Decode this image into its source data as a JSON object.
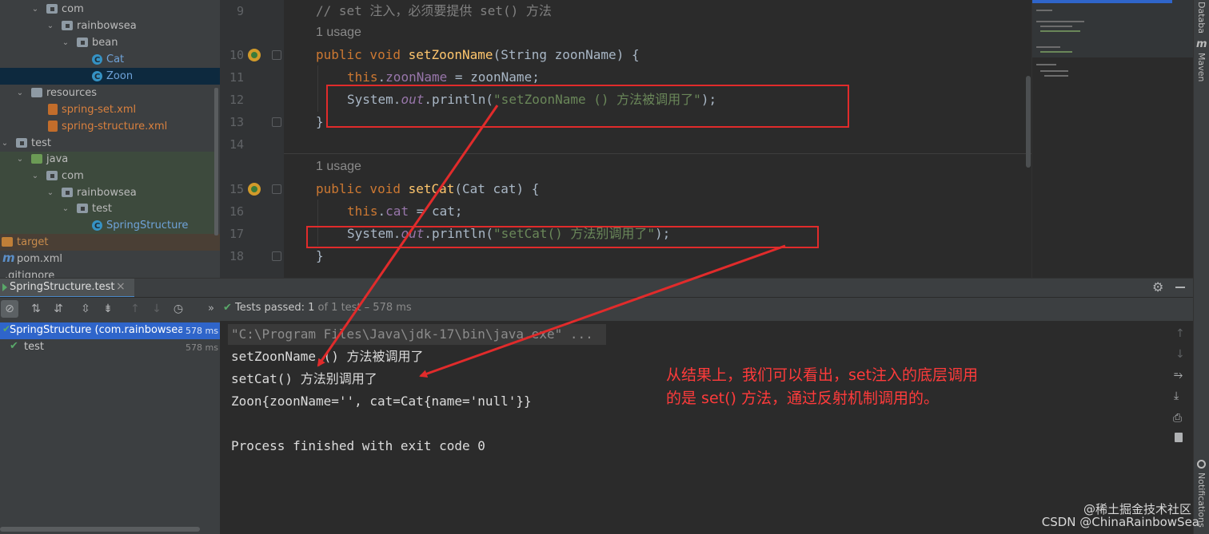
{
  "project_tree": {
    "items": [
      {
        "label": "com",
        "kind": "folder",
        "open": true
      },
      {
        "label": "rainbowsea",
        "kind": "folder",
        "open": true
      },
      {
        "label": "bean",
        "kind": "folder",
        "open": true
      },
      {
        "label": "Cat",
        "kind": "class"
      },
      {
        "label": "Zoon",
        "kind": "class",
        "selected": true
      },
      {
        "label": "resources",
        "kind": "res",
        "open": true
      },
      {
        "label": "spring-set.xml",
        "kind": "xml"
      },
      {
        "label": "spring-structure.xml",
        "kind": "xml"
      },
      {
        "label": "test",
        "kind": "folder",
        "open": true
      },
      {
        "label": "java",
        "kind": "src",
        "open": true
      },
      {
        "label": "com",
        "kind": "folder",
        "open": true
      },
      {
        "label": "rainbowsea",
        "kind": "folder",
        "open": true
      },
      {
        "label": "test",
        "kind": "folder",
        "open": true
      },
      {
        "label": "SpringStructure",
        "kind": "class"
      },
      {
        "label": "target",
        "kind": "tgt"
      },
      {
        "label": "pom.xml",
        "kind": "mvn"
      },
      {
        "label": ".gitignore",
        "kind": "plain"
      }
    ]
  },
  "editor": {
    "line_numbers": [
      "9",
      "10",
      "11",
      "12",
      "13",
      "14",
      "15",
      "16",
      "17",
      "18"
    ],
    "comment": "// set 注入，必须要提供 set() 方法",
    "usage_hint": "1 usage",
    "method1": {
      "mod": "public void ",
      "name": "setZoonName",
      "params": "(String zoonName) {"
    },
    "assign1": {
      "kw": "this",
      "dot": ".",
      "field": "zoonName",
      "rest": " = zoonName;"
    },
    "print1": {
      "pre": "System.",
      "out": "out",
      "mid": ".println(",
      "str": "\"setZoonName () 方法被调用了\"",
      "end": ");"
    },
    "close": "}",
    "method2": {
      "mod": "public void ",
      "name": "setCat",
      "params": "(Cat cat) {"
    },
    "assign2": {
      "kw": "this",
      "dot": ".",
      "field": "cat",
      "rest": " = cat;"
    },
    "print2": {
      "pre": "System.",
      "out": "out",
      "mid": ".println(",
      "str": "\"setCat() 方法别调用了\"",
      "end": ");"
    }
  },
  "right_bar": {
    "database": "Database",
    "maven": "Maven",
    "notifications": "Notifications"
  },
  "run_panel": {
    "tab_title": "SpringStructure.test",
    "close_glyph": "×",
    "status_passed": "Tests passed: ",
    "status_count": "1",
    "status_rest": " of 1 test – 578 ms",
    "overflow": "»",
    "tree": [
      {
        "label": "SpringStructure (com.rainbowsea.te",
        "time": "578 ms",
        "selected": true
      },
      {
        "label": "test",
        "time": "578 ms",
        "selected": false
      }
    ]
  },
  "console": {
    "lines": [
      "\"C:\\Program Files\\Java\\jdk-17\\bin\\java.exe\" ...",
      "setZoonName () 方法被调用了",
      "setCat() 方法别调用了",
      "Zoon{zoonName='', cat=Cat{name='null'}}",
      "",
      "Process finished with exit code 0"
    ]
  },
  "annotation": {
    "line1": "从结果上，我们可以看出，set注入的底层调用",
    "line2": "的是 set() 方法，通过反射机制调用的。"
  },
  "watermark": {
    "line1": "@稀土掘金技术社区",
    "line2": "CSDN @ChinaRainbowSea"
  },
  "colors": {
    "annotation_red": "#e12b2b",
    "keyword": "#cc7832",
    "string": "#6a8759",
    "field": "#9876aa",
    "method": "#ffc66d"
  }
}
